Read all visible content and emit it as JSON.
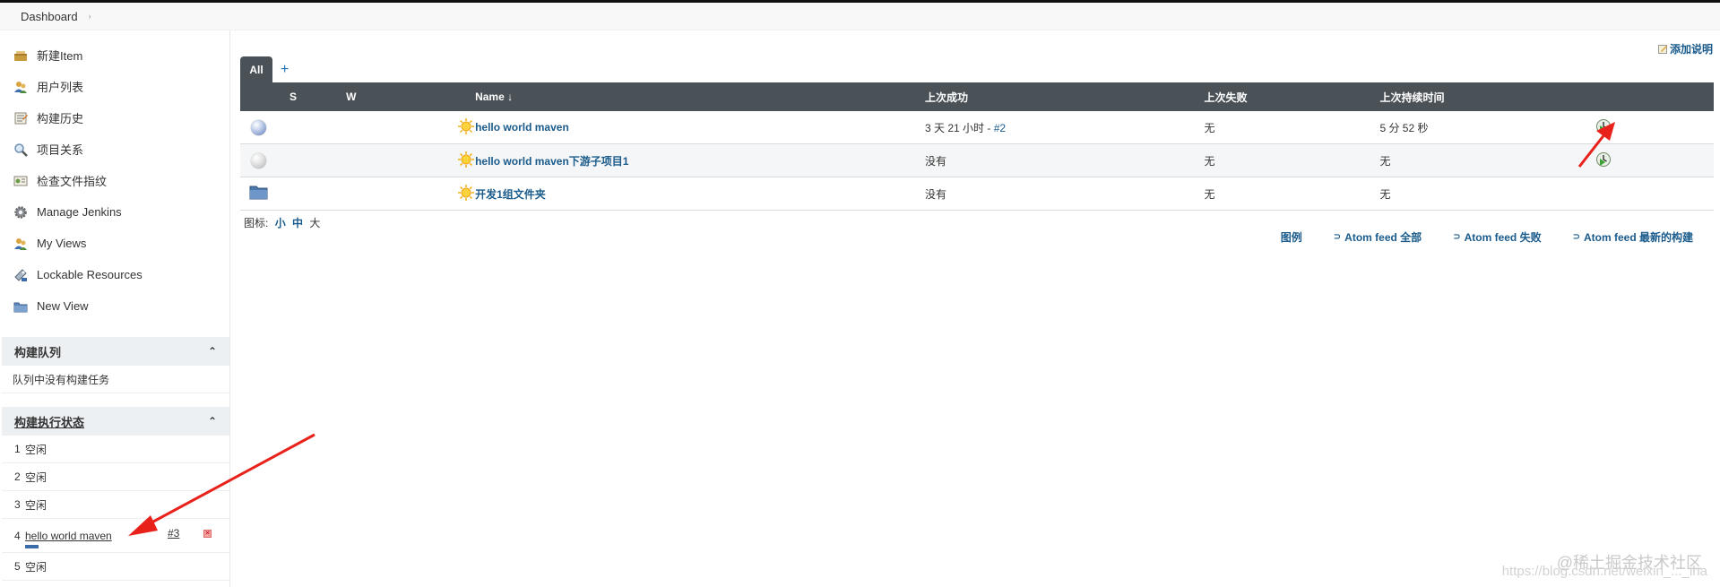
{
  "breadcrumb": {
    "root": "Dashboard",
    "separator": "›"
  },
  "sidebar": {
    "items": [
      {
        "label": "新建Item",
        "icon": "new-item-icon"
      },
      {
        "label": "用户列表",
        "icon": "users-icon"
      },
      {
        "label": "构建历史",
        "icon": "build-history-icon"
      },
      {
        "label": "项目关系",
        "icon": "search-icon"
      },
      {
        "label": "检查文件指纹",
        "icon": "fingerprint-icon"
      },
      {
        "label": "Manage Jenkins",
        "icon": "gear-icon"
      },
      {
        "label": "My Views",
        "icon": "users-icon"
      },
      {
        "label": "Lockable Resources",
        "icon": "lock-icon"
      },
      {
        "label": "New View",
        "icon": "folder-icon"
      }
    ]
  },
  "build_queue": {
    "title": "构建队列",
    "empty_text": "队列中没有构建任务",
    "collapse": "⌃"
  },
  "executors": {
    "title": "构建执行状态",
    "collapse": "⌃",
    "rows": [
      {
        "num": "1",
        "status": "空闲"
      },
      {
        "num": "2",
        "status": "空闲"
      },
      {
        "num": "3",
        "status": "空闲"
      },
      {
        "num": "4",
        "job": "hello world maven",
        "build": "#3",
        "progress": 0.15
      },
      {
        "num": "5",
        "status": "空闲"
      }
    ]
  },
  "main": {
    "add_description": "添加说明",
    "tabs": {
      "active": "All",
      "add": "+"
    },
    "columns": {
      "s": "S",
      "w": "W",
      "name": "Name ↓",
      "last_success": "上次成功",
      "last_failure": "上次失败",
      "last_duration": "上次持续时间"
    },
    "jobs": [
      {
        "status": "blue",
        "name": "hello world maven",
        "last_success": "3 天 21 小时 - ",
        "last_success_build": "#2",
        "last_failure": "无",
        "last_duration": "5 分 52 秒",
        "schedule": true
      },
      {
        "status": "grey",
        "name": "hello world maven下游子项目1",
        "last_success": "没有",
        "last_success_build": "",
        "last_failure": "无",
        "last_duration": "无",
        "schedule": true
      },
      {
        "status": "folder",
        "name": "开发1组文件夹",
        "last_success": "没有",
        "last_success_build": "",
        "last_failure": "无",
        "last_duration": "无",
        "schedule": false
      }
    ],
    "icon_size": {
      "label": "图标:",
      "small": "小",
      "medium": "中",
      "large": "大"
    },
    "feeds": {
      "legend": "图例",
      "all": "Atom feed 全部",
      "failed": "Atom feed 失败",
      "latest": "Atom feed 最新的构建"
    }
  },
  "watermark": {
    "text": "@稀土掘金技术社区",
    "url": "https://blog.csdn.net/weixin_..._iha"
  },
  "colors": {
    "header": "#4b5257",
    "link": "#1a5b8c",
    "annotation_arrow": "#e8221b"
  }
}
